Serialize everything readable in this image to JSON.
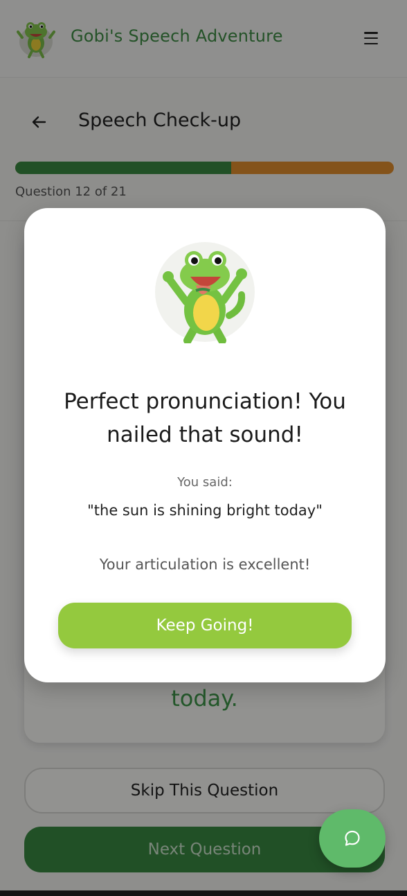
{
  "app": {
    "brand_name": "Gobi's Speech Adventure",
    "mascot": "frog-mascot-icon",
    "menu_icon": "hamburger-menu-icon"
  },
  "page": {
    "title": "Speech Check-up",
    "back_icon": "arrow-left-icon",
    "progress": {
      "completed_fraction": 0.57,
      "label": "Question 12 of 21",
      "colors": {
        "completed": "#3a8a43",
        "remaining": "#e48f2e"
      }
    },
    "card_tail_text": "today.",
    "skip_label": "Skip This Question",
    "next_label": "Next Question"
  },
  "modal": {
    "title": "Perfect pronunciation! You nailed that sound!",
    "you_said_label": "You said:",
    "you_said_text": "\"the sun is shining bright today\"",
    "feedback": "Your articulation is excellent!",
    "button_label": "Keep Going!",
    "button_color": "#94c93e"
  },
  "chat": {
    "icon": "chat-bubble-icon",
    "color": "#5fba6a"
  }
}
